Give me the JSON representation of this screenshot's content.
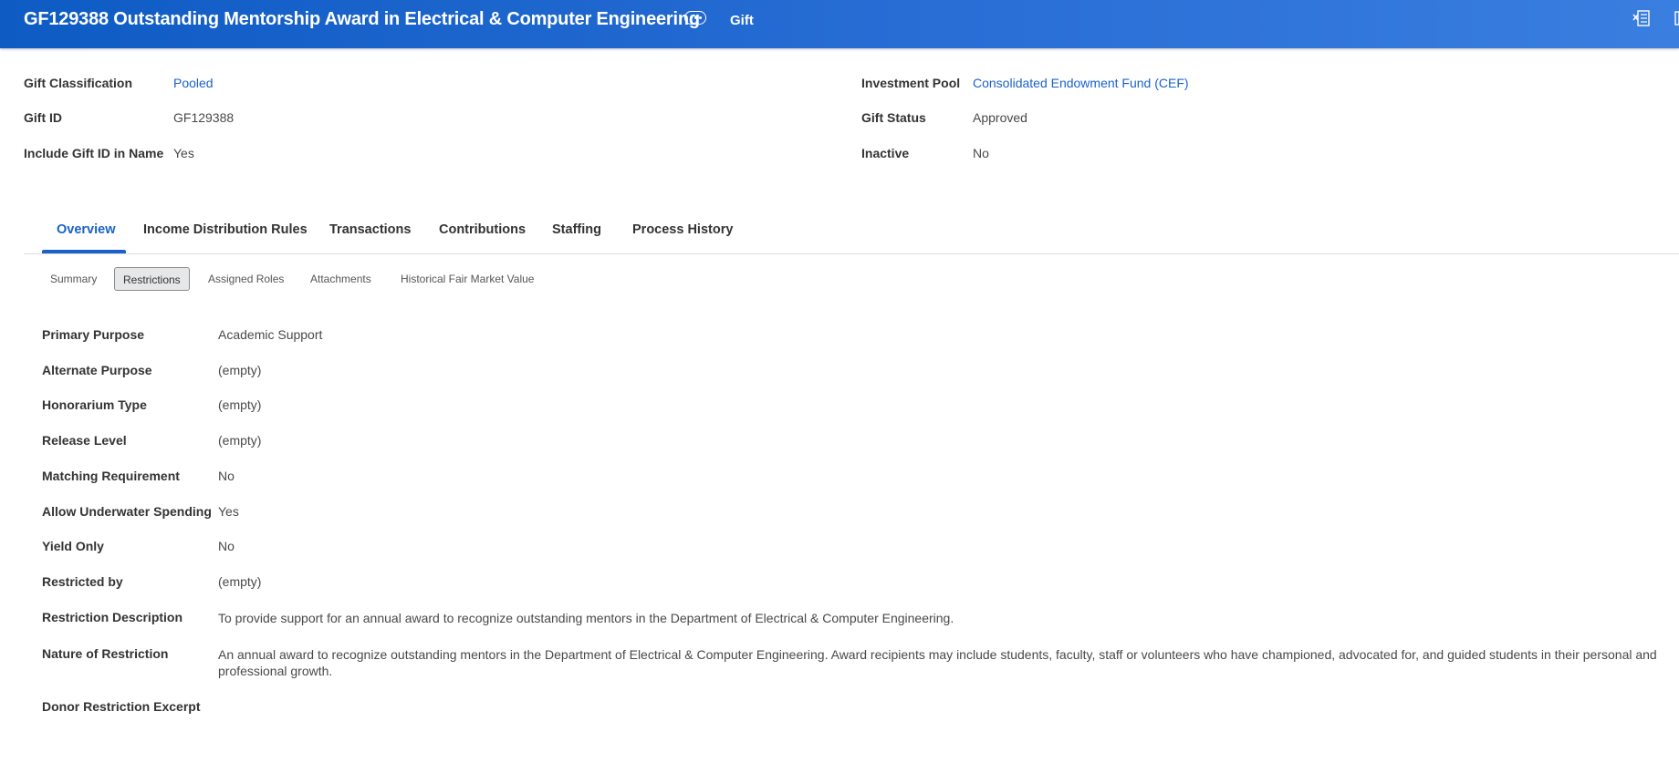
{
  "header": {
    "title": "GF129388 Outstanding Mentorship Award in Electrical & Computer Engineering",
    "type": "Gift",
    "related_actions_icon": "ellipsis-icon",
    "export_icon": "excel-export-icon"
  },
  "summary_fields": {
    "left": [
      {
        "label": "Gift Classification",
        "value": "Pooled",
        "link": true
      },
      {
        "label": "Gift ID",
        "value": "GF129388",
        "link": false
      },
      {
        "label": "Include Gift ID in Name",
        "value": "Yes",
        "link": false
      }
    ],
    "right": [
      {
        "label": "Investment Pool",
        "value": "Consolidated Endowment Fund (CEF)",
        "link": true
      },
      {
        "label": "Gift Status",
        "value": "Approved",
        "link": false
      },
      {
        "label": "Inactive",
        "value": "No",
        "link": false
      }
    ]
  },
  "tabs": [
    {
      "label": "Overview",
      "active": true
    },
    {
      "label": "Income Distribution Rules",
      "active": false
    },
    {
      "label": "Transactions",
      "active": false
    },
    {
      "label": "Contributions",
      "active": false
    },
    {
      "label": "Staffing",
      "active": false
    },
    {
      "label": "Process History",
      "active": false
    }
  ],
  "subtabs": [
    {
      "label": "Summary",
      "active": false
    },
    {
      "label": "Restrictions",
      "active": true
    },
    {
      "label": "Assigned Roles",
      "active": false
    },
    {
      "label": "Attachments",
      "active": false
    },
    {
      "label": "Historical Fair Market Value",
      "active": false
    }
  ],
  "restrictions": [
    {
      "label": "Primary Purpose",
      "value": "Academic Support",
      "link": true
    },
    {
      "label": "Alternate Purpose",
      "value": "(empty)",
      "link": false
    },
    {
      "label": "Honorarium Type",
      "value": "(empty)",
      "link": false
    },
    {
      "label": "Release Level",
      "value": "(empty)",
      "link": false
    },
    {
      "label": "Matching Requirement",
      "value": "No",
      "link": false
    },
    {
      "label": "Allow Underwater Spending",
      "value": "Yes",
      "link": false
    },
    {
      "label": "Yield Only",
      "value": "No",
      "link": false
    },
    {
      "label": "Restricted by",
      "value": "(empty)",
      "link": false
    },
    {
      "label": "Restriction Description",
      "value": "To provide support for an annual award to recognize outstanding mentors in the Department of Electrical & Computer Engineering.",
      "link": false
    },
    {
      "label": "Nature of Restriction",
      "value": "An annual award to recognize outstanding mentors in the Department of Electrical & Computer Engineering. Award recipients may include students, faculty, staff or volunteers who have championed, advocated for, and guided students in their personal and professional growth.",
      "link": false
    },
    {
      "label": "Donor Restriction Excerpt",
      "value": "",
      "link": false
    }
  ],
  "colors": {
    "header_blue": "#1a62c9",
    "link_blue": "#1a62c9",
    "active_subtab_bg": "#e6e7e8"
  }
}
